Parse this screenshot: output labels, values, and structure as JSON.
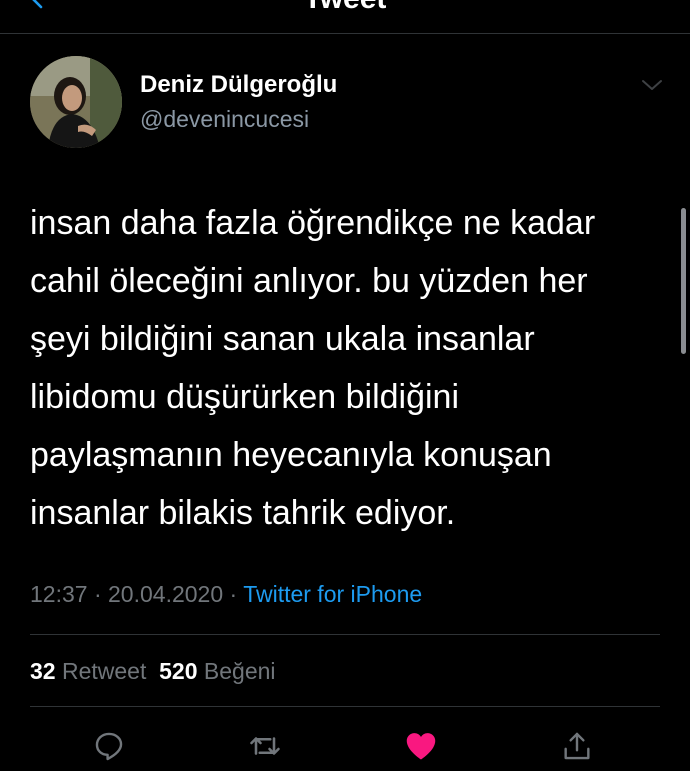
{
  "header": {
    "title": "Tweet",
    "back_icon": "chevron-left-icon"
  },
  "tweet": {
    "author": {
      "display_name": "Deniz Dülgeroğlu",
      "handle": "@devenincucesi"
    },
    "text_lines": [
      "insan daha fazla öğrendikçe ne kadar",
      "cahil öleceğini anlıyor. bu yüzden her",
      "şeyi bildiğini sanan ukala insanlar",
      "libidomu düşürürken bildiğini",
      "paylaşmanın heyecanıyla konuşan",
      "insanlar bilakis tahrik ediyor."
    ],
    "time": "12:37",
    "separator": "·",
    "date": "20.04.2020",
    "source": "Twitter for iPhone",
    "retweet_count": "32",
    "retweet_label": "Retweet",
    "like_count": "520",
    "like_label": "Beğeni"
  },
  "actions": {
    "reply_icon": "reply-icon",
    "retweet_icon": "retweet-icon",
    "like_icon": "heart-icon",
    "share_icon": "share-icon"
  },
  "colors": {
    "background": "#000000",
    "accent": "#1d9bf0",
    "like": "#f91880",
    "secondary_text": "#71767b",
    "divider": "#2f3336"
  }
}
